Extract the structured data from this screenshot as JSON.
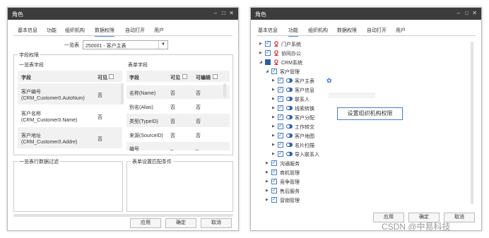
{
  "window1": {
    "title": "角色",
    "tabs": [
      "基本信息",
      "功能",
      "组织机构",
      "数据权限",
      "自动打开",
      "用户"
    ],
    "list_label": "一览表",
    "list_value": "250001 - 客户主表",
    "field_perm_title": "字段权限",
    "list_fields_title": "一览表字段",
    "form_fields_title": "表单字段",
    "col_field": "字段",
    "col_visible": "可见",
    "col_editable": "可编辑",
    "list_rows": [
      {
        "name": "客户编号",
        "sub": "(CRM_Customer0.AutoNum)",
        "visible": "否"
      },
      {
        "name": "客户名称",
        "sub": "(CRM_Customer0.Name)",
        "visible": "否"
      },
      {
        "name": "客户地址",
        "sub": "(CRM_Customer0.Addre)",
        "visible": "否"
      }
    ],
    "form_rows": [
      {
        "name": "名称(Name)",
        "visible": "否",
        "edit": "否"
      },
      {
        "name": "别名(Alias)",
        "visible": "否",
        "edit": "否"
      },
      {
        "name": "类型(TypeID)",
        "visible": "否",
        "edit": "否"
      },
      {
        "name": "来源(SourceID)",
        "visible": "否",
        "edit": "否"
      },
      {
        "name": "编号",
        "visible": "_",
        "edit": "_"
      }
    ],
    "filter_title": "一览表行数据过滤",
    "match_title": "表单设置匹配条件",
    "buttons": {
      "apply": "应用",
      "ok": "确定",
      "cancel": "取消"
    }
  },
  "window2": {
    "title": "角色",
    "tabs": [
      "基本信息",
      "功能",
      "组织机构",
      "数据权限",
      "自动打开",
      "用户"
    ],
    "tree": [
      {
        "label": "门户系统",
        "indent": 0,
        "tri": "▶",
        "check": "checked",
        "icon": "red"
      },
      {
        "label": "协同办公",
        "indent": 0,
        "tri": "▶",
        "check": "checked",
        "icon": "red"
      },
      {
        "label": "CRM系统",
        "indent": 0,
        "tri": "◢",
        "check": "partial",
        "icon": "red"
      },
      {
        "label": "客户管理",
        "indent": 1,
        "tri": "◢",
        "check": "checked",
        "icon": "none"
      },
      {
        "label": "客户主表",
        "indent": 2,
        "tri": "▶",
        "check": "checked",
        "icon": "toggle",
        "gear": true
      },
      {
        "label": "客户信息",
        "indent": 2,
        "tri": "▶",
        "check": "checked",
        "icon": "toggle"
      },
      {
        "label": "联系人",
        "indent": 2,
        "tri": "▶",
        "check": "checked",
        "icon": "toggle"
      },
      {
        "label": "线索转换",
        "indent": 2,
        "tri": "▶",
        "check": "checked",
        "icon": "toggle"
      },
      {
        "label": "客户分配",
        "indent": 2,
        "tri": "▶",
        "check": "checked",
        "icon": "toggle"
      },
      {
        "label": "工作转交",
        "indent": 2,
        "tri": "▶",
        "check": "checked",
        "icon": "toggle"
      },
      {
        "label": "客户地图",
        "indent": 2,
        "tri": "▶",
        "check": "checked",
        "icon": "toggle"
      },
      {
        "label": "名片扫描",
        "indent": 2,
        "tri": "▶",
        "check": "checked",
        "icon": "toggle"
      },
      {
        "label": "导入联系人",
        "indent": 2,
        "tri": "▶",
        "check": "checked",
        "icon": "toggle"
      },
      {
        "label": "沟通服务",
        "indent": 1,
        "tri": "▶",
        "check": "checked",
        "icon": "none"
      },
      {
        "label": "商机管理",
        "indent": 1,
        "tri": "▶",
        "check": "checked",
        "icon": "none"
      },
      {
        "label": "竞争管理",
        "indent": 1,
        "tri": "▶",
        "check": "checked",
        "icon": "none"
      },
      {
        "label": "售后服务",
        "indent": 1,
        "tri": "▶",
        "check": "checked",
        "icon": "none"
      },
      {
        "label": "营销管理",
        "indent": 1,
        "tri": "▶",
        "check": "checked",
        "icon": "none"
      }
    ],
    "tooltip": "设置组织机构权限",
    "buttons": {
      "apply": "应用",
      "ok": "确定",
      "cancel": "取消"
    }
  },
  "watermark": "CSDN @中易科技"
}
